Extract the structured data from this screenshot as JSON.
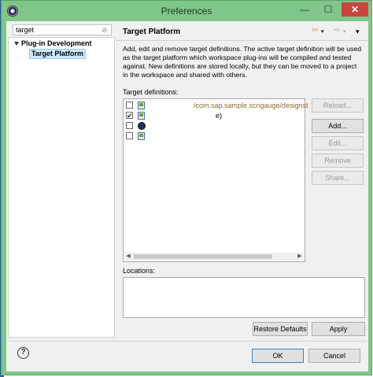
{
  "window": {
    "title": "Preferences",
    "minimize_glyph": "—",
    "maximize_glyph": "☐",
    "close_glyph": "✕",
    "accent_color": "#80c58a",
    "icon": "eclipse-app-icon"
  },
  "filter": {
    "value": "target",
    "clear_glyph": "⊘"
  },
  "tree": {
    "twisty_icon": "expand-triangle-icon",
    "parent": "Plug-in Development",
    "child": "Target Platform"
  },
  "page": {
    "title": "Target Platform",
    "nav_back_glyph": "⇦",
    "nav_forward_glyph": "⇨",
    "nav_menu_glyph": "▾",
    "description": "Add, edit and remove target definitions.  The active target definition will be used as the target platform which workspace plug-ins will be compiled and tested against.  New definitions are stored locally, but they can be moved to a project in the workspace and shared with others.",
    "definitions_label": "Target definitions:",
    "locations_label": "Locations:"
  },
  "definitions": [
    {
      "checked": false,
      "check_glyph": "",
      "icon": "target-file-icon",
      "text": "/com.sap.sample.scngauge/designst",
      "color": "#8a6a2a"
    },
    {
      "checked": true,
      "check_glyph": "✔",
      "icon": "target-file-icon",
      "text": "e)",
      "color": "#000000"
    },
    {
      "checked": false,
      "check_glyph": "",
      "icon": "eclipse-target-icon",
      "text": "",
      "color": "#000000"
    },
    {
      "checked": false,
      "check_glyph": "",
      "icon": "target-file-icon",
      "text": "",
      "color": "#000000"
    }
  ],
  "side_buttons": {
    "reload": "Reload...",
    "add": "Add...",
    "edit": "Edit...",
    "remove": "Remove",
    "share": "Share..."
  },
  "bottom": {
    "restore_defaults": "Restore Defaults",
    "apply": "Apply",
    "help_glyph": "?",
    "ok": "OK",
    "cancel": "Cancel"
  },
  "scrollbar": {
    "left_glyph": "◀",
    "right_glyph": "▶"
  }
}
